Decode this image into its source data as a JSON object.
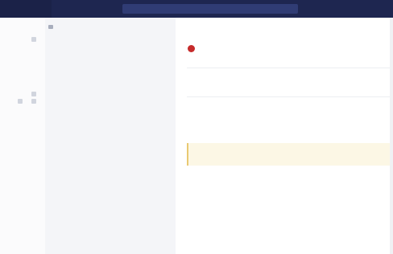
{
  "topbar": {
    "brand": "",
    "search_placeholder": ""
  },
  "rail": {
    "label": ""
  },
  "panel": {
    "breadcrumb": "",
    "sections": [
      {
        "heading": "",
        "description": ""
      },
      {
        "heading": "",
        "description": ""
      },
      {
        "heading": "",
        "description": ""
      }
    ]
  },
  "content": {
    "account_name": "",
    "account_sub": "",
    "account_desc": "",
    "field_label": "",
    "section_title": "",
    "warning_line1": "",
    "warning_line2": "",
    "info_text": "",
    "info_text2": "",
    "link_text": ""
  },
  "colors": {
    "topbar": "#1e2650",
    "search": "#303c74",
    "avatar": "#c62b2b",
    "warning_bg": "#fcf7e5",
    "warning_border": "#e9c972",
    "link": "#6e8fd6"
  }
}
